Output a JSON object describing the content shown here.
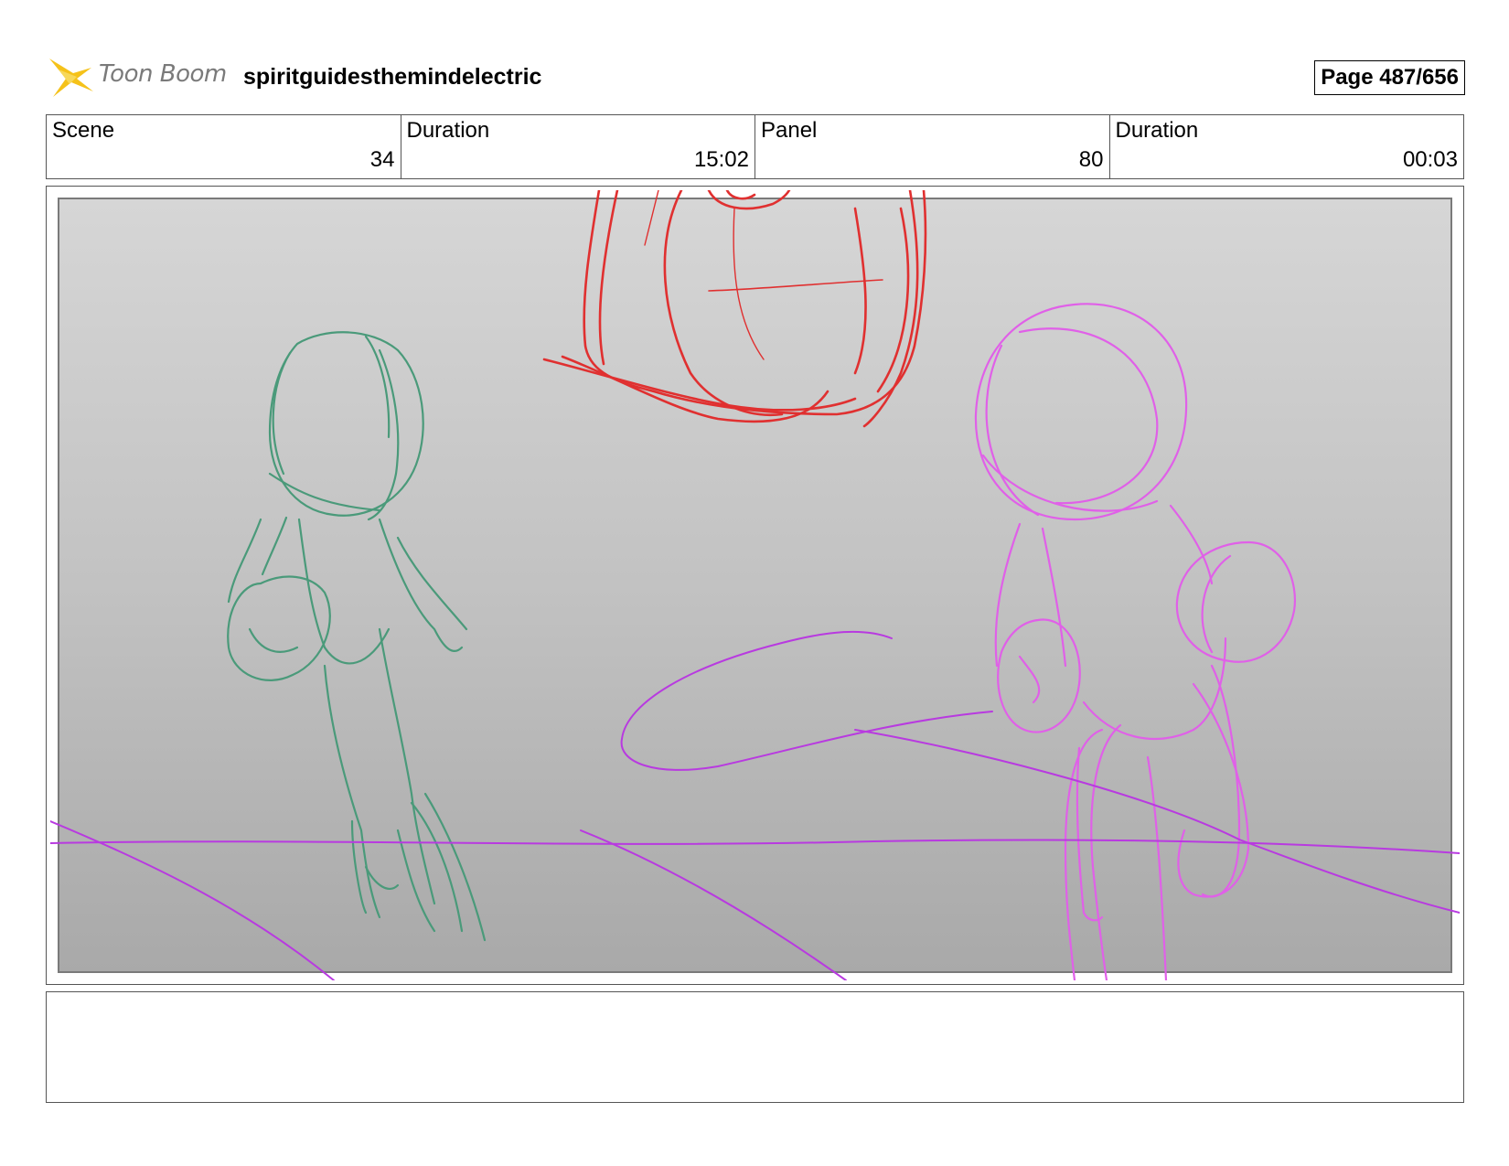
{
  "header": {
    "logo_text": "Toon Boom",
    "project_title": "spiritguidesthemindelectric",
    "page_label": "Page 487/656"
  },
  "info": {
    "scene_label": "Scene",
    "scene_value": "34",
    "scene_duration_label": "Duration",
    "scene_duration_value": "15:02",
    "panel_label": "Panel",
    "panel_value": "80",
    "panel_duration_label": "Duration",
    "panel_duration_value": "00:03"
  },
  "sketch_colors": {
    "green": "#4a9a7a",
    "red": "#e03030",
    "magenta": "#e060e8",
    "purple": "#b83ae0"
  },
  "notes": {
    "text": ""
  }
}
